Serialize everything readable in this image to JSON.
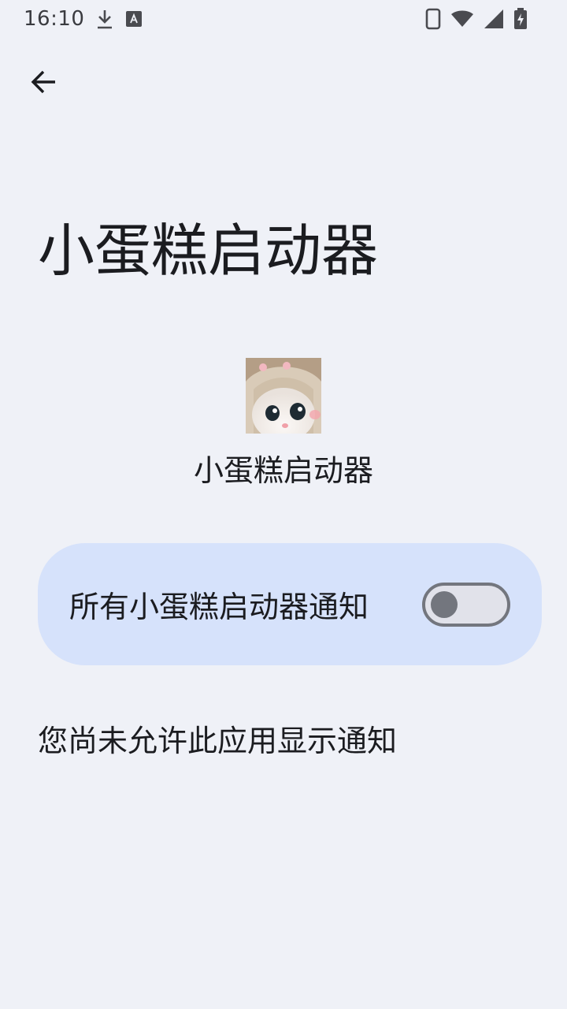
{
  "status_bar": {
    "time": "16:10",
    "icons": [
      "download-icon",
      "text-a-icon",
      "phone-icon",
      "wifi-icon",
      "signal-icon",
      "battery-charging-icon"
    ]
  },
  "nav": {
    "back_icon": "arrow-left-icon"
  },
  "page": {
    "title": "小蛋糕启动器"
  },
  "app": {
    "name": "小蛋糕启动器",
    "icon": "cat-avatar"
  },
  "notification_toggle": {
    "label": "所有小蛋糕启动器通知",
    "enabled": false
  },
  "info": {
    "text": "您尚未允许此应用显示通知"
  },
  "colors": {
    "background": "#eff1f7",
    "card": "#d6e2fb",
    "switch_outline": "#73767e",
    "text": "#1b1c20"
  }
}
